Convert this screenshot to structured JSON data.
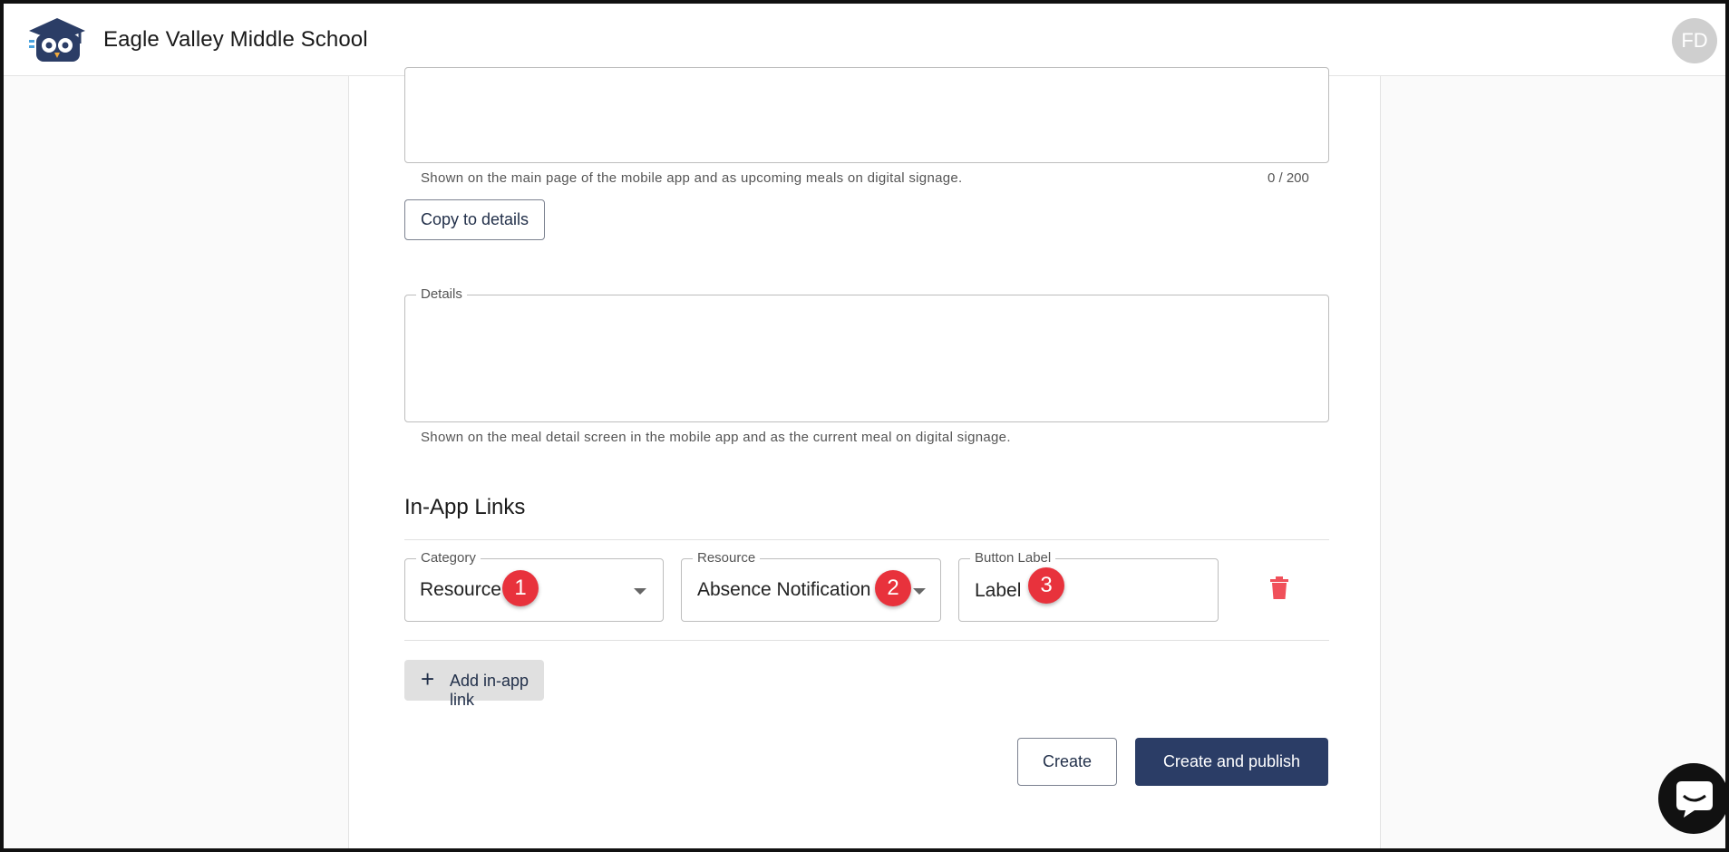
{
  "header": {
    "school_name": "Eagle Valley Middle School",
    "avatar_initials": "FD"
  },
  "summary": {
    "helper": "Shown on the main page of the mobile app and as upcoming meals on digital signage.",
    "counter": "0 / 200",
    "copy_button": "Copy to details"
  },
  "details": {
    "label": "Details",
    "helper": "Shown on the meal detail screen in the mobile app and as the current meal on digital signage."
  },
  "in_app_links": {
    "title": "In-App Links",
    "category": {
      "label": "Category",
      "value": "Resource",
      "badge": "1"
    },
    "resource": {
      "label": "Resource",
      "value": "Absence Notification",
      "badge": "2"
    },
    "button_label": {
      "label": "Button Label",
      "value": "Label",
      "badge": "3"
    },
    "add_button": "Add in-app link"
  },
  "actions": {
    "create": "Create",
    "create_publish": "Create and publish"
  },
  "colors": {
    "primary": "#2b3d66",
    "delete": "#f0505a",
    "badge": "#e8323c"
  },
  "icons": {
    "logo": "owl-graduate-icon",
    "delete": "trash-icon",
    "add": "plus-icon",
    "chat": "chat-bubble-icon"
  }
}
